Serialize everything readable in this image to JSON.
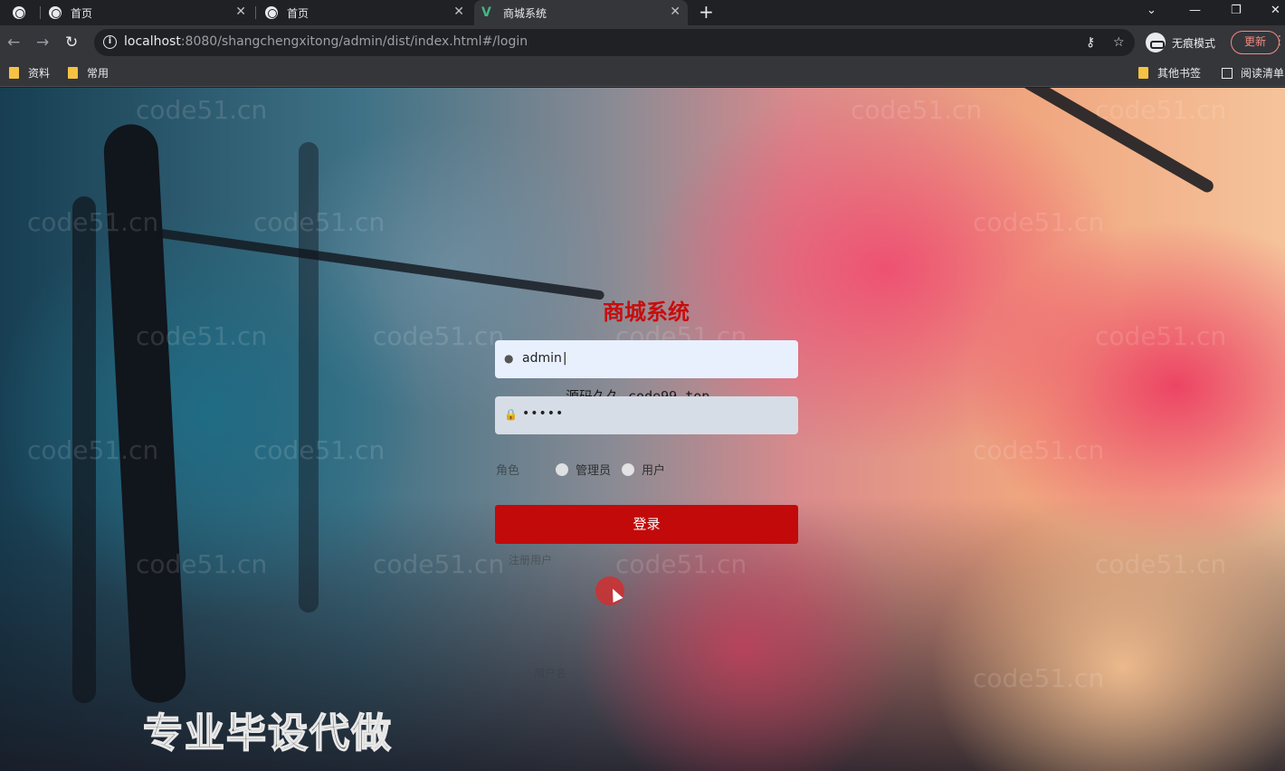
{
  "browser": {
    "tabs": [
      {
        "label": "",
        "type": "pinned"
      },
      {
        "label": "首页"
      },
      {
        "label": "首页"
      },
      {
        "label": "商城系统",
        "active": true
      }
    ],
    "url_host": "localhost",
    "url_rest": ":8080/shangchengxitong/admin/dist/index.html#/login",
    "incognito_label": "无痕模式",
    "update_label": "更新",
    "bookmarks": [
      "资料",
      "常用"
    ],
    "bookmarks_right": [
      "其他书签",
      "阅读清单"
    ]
  },
  "login": {
    "title": "商城系统",
    "username_value": "admin",
    "password_dots": "•••••",
    "role_label": "角色",
    "roles": [
      "管理员",
      "用户"
    ],
    "submit_label": "登录",
    "ghost_register": "注册用户",
    "ghost_username": "用户名"
  },
  "overlays": {
    "watermark_text": "code51.cn",
    "center_watermark": "源码久久-code99.top",
    "bottom_banner": "专业毕设代做"
  },
  "colors": {
    "accent": "#c20a0a",
    "title": "#c70d0d",
    "update": "#f28b82"
  }
}
